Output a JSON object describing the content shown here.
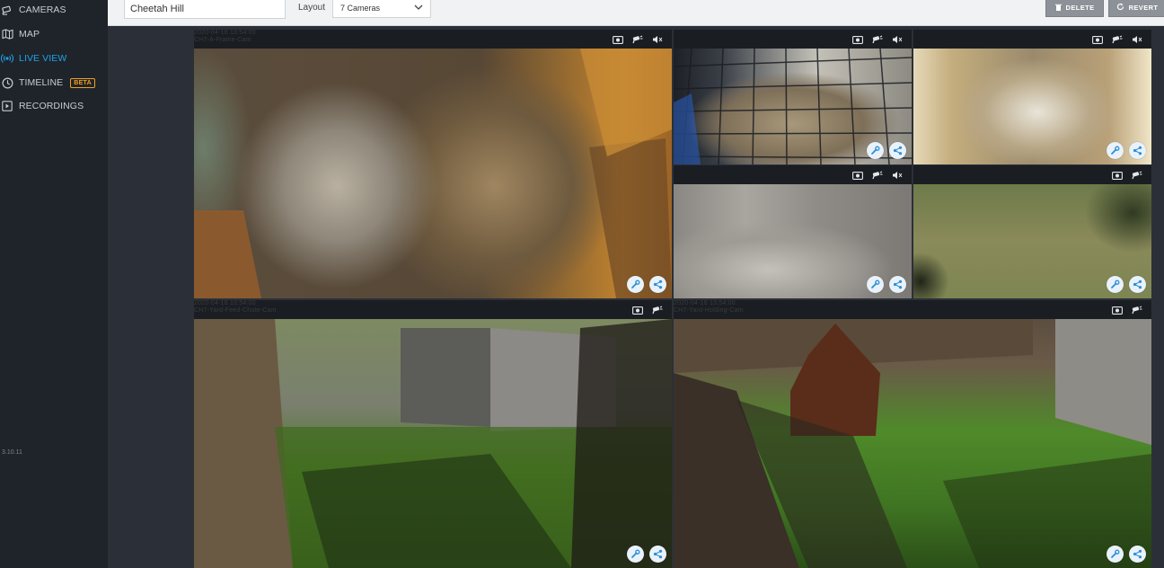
{
  "sidebar": {
    "items": [
      {
        "label": "CAMERAS",
        "icon": "camera-icon"
      },
      {
        "label": "MAP",
        "icon": "map-icon"
      },
      {
        "label": "LIVE VIEW",
        "icon": "live-signal-icon",
        "active": true
      },
      {
        "label": "TIMELINE",
        "icon": "clock-icon",
        "badge": "BETA"
      },
      {
        "label": "RECORDINGS",
        "icon": "play-icon"
      }
    ],
    "version": "3.10.11"
  },
  "header": {
    "view_name": "Cheetah Hill",
    "layout_label": "Layout",
    "layout_value": "7 Cameras",
    "delete_label": "DELETE",
    "revert_label": "REVERT"
  },
  "cameras": [
    {
      "stamp_time": "2020-04-16 13:54:00",
      "stamp_name": "CH7-A-Frame-Cam"
    },
    {
      "stamp_time": "",
      "stamp_name": ""
    },
    {
      "stamp_time": "",
      "stamp_name": ""
    },
    {
      "stamp_time": "",
      "stamp_name": ""
    },
    {
      "stamp_time": "",
      "stamp_name": ""
    },
    {
      "stamp_time": "2020-04-16 13:54:00",
      "stamp_name": "CH7-Yard-Feed-Chute-Cam"
    },
    {
      "stamp_time": "2020-04-16 13:54:00",
      "stamp_name": "CH7-Yard-Holding-Cam"
    }
  ],
  "colors": {
    "accent": "#1fa3e8",
    "beta": "#f0a020",
    "sidebar_bg": "#1f242b",
    "content_bg": "#2b3038"
  }
}
